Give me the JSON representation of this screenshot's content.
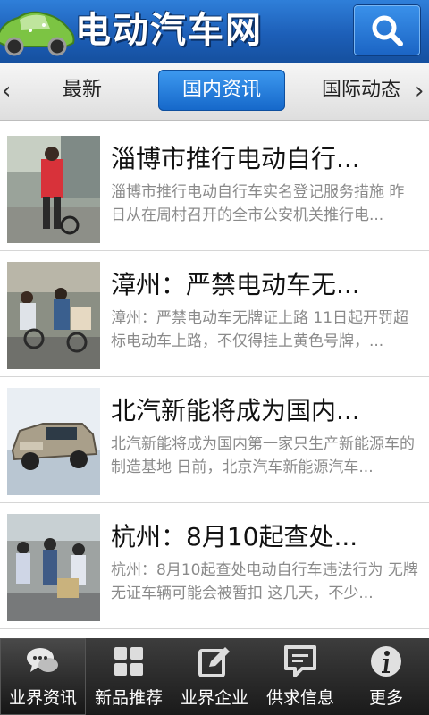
{
  "header": {
    "title": "电动汽车网",
    "logo_icon": "green-car-logo",
    "search_icon": "search-icon"
  },
  "tabs": {
    "prev_arrow": "‹",
    "next_arrow": "›",
    "items": [
      {
        "label": "最新"
      },
      {
        "label": "国内资讯",
        "active": true
      },
      {
        "label": "国际动态"
      }
    ]
  },
  "news": [
    {
      "title": "淄博市推行电动自行...",
      "desc": "淄博市推行电动自行车实名登记服务措施 昨日从在周村召开的全市公安机关推行电..."
    },
    {
      "title": "漳州：严禁电动车无...",
      "desc": "漳州：严禁电动车无牌证上路 11日起开罚超标电动车上路，不仅得挂上黄色号牌，..."
    },
    {
      "title": "北汽新能将成为国内...",
      "desc": "北汽新能将成为国内第一家只生产新能源车的制造基地 日前，北京汽车新能源汽车..."
    },
    {
      "title": "杭州：8月10起查处...",
      "desc": "杭州：8月10起查处电动自行车违法行为 无牌无证车辆可能会被暂扣  这几天，不少..."
    }
  ],
  "bottom_nav": [
    {
      "label": "业界资讯",
      "icon": "chat-bubble-icon",
      "active": true
    },
    {
      "label": "新品推荐",
      "icon": "grid-icon"
    },
    {
      "label": "业界企业",
      "icon": "edit-icon"
    },
    {
      "label": "供求信息",
      "icon": "message-box-icon"
    },
    {
      "label": "更多",
      "icon": "info-icon"
    }
  ],
  "colors": {
    "header_blue": "#1d5fb8",
    "tab_active": "#1567c9",
    "nav_dark": "#1a1a1a",
    "title_text": "#111111",
    "desc_text": "#8a8a8a"
  }
}
